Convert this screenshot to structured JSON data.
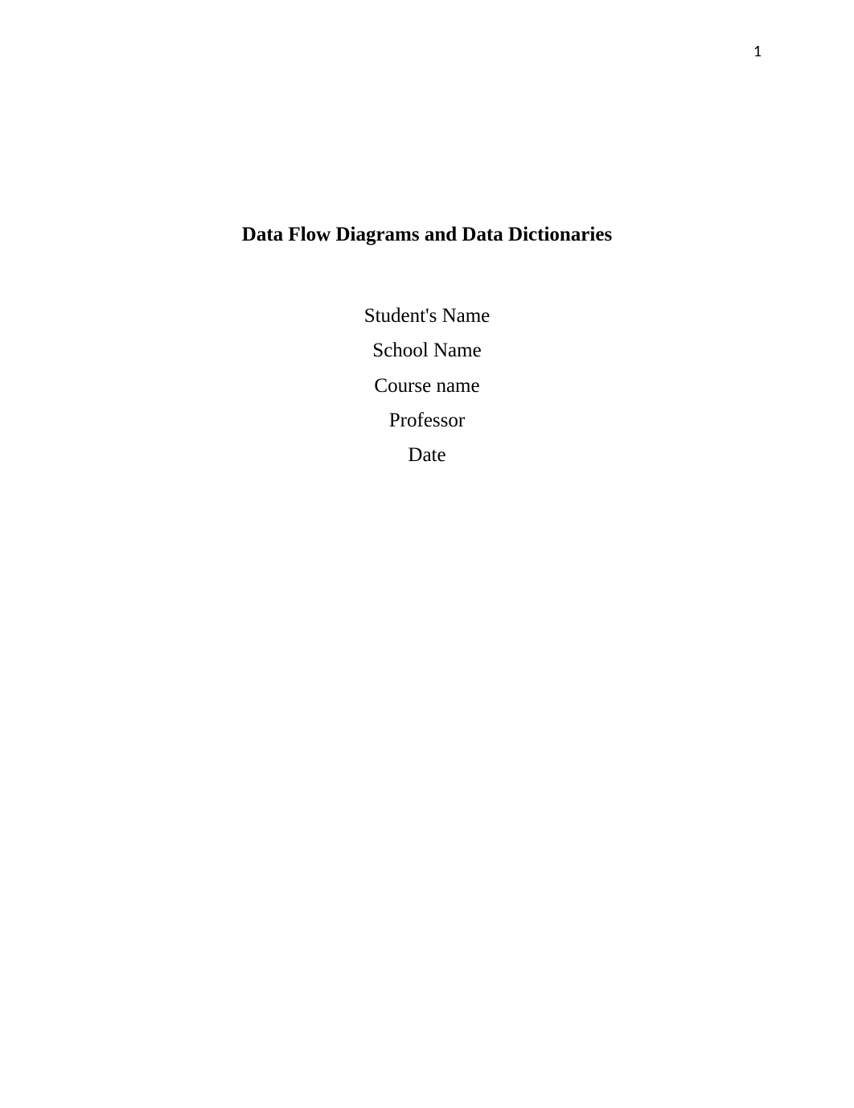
{
  "page_number": "1",
  "title": "Data Flow Diagrams and Data Dictionaries",
  "lines": {
    "student": "Student's Name",
    "school": "School Name",
    "course": "Course name",
    "professor": "Professor",
    "date": "Date"
  }
}
